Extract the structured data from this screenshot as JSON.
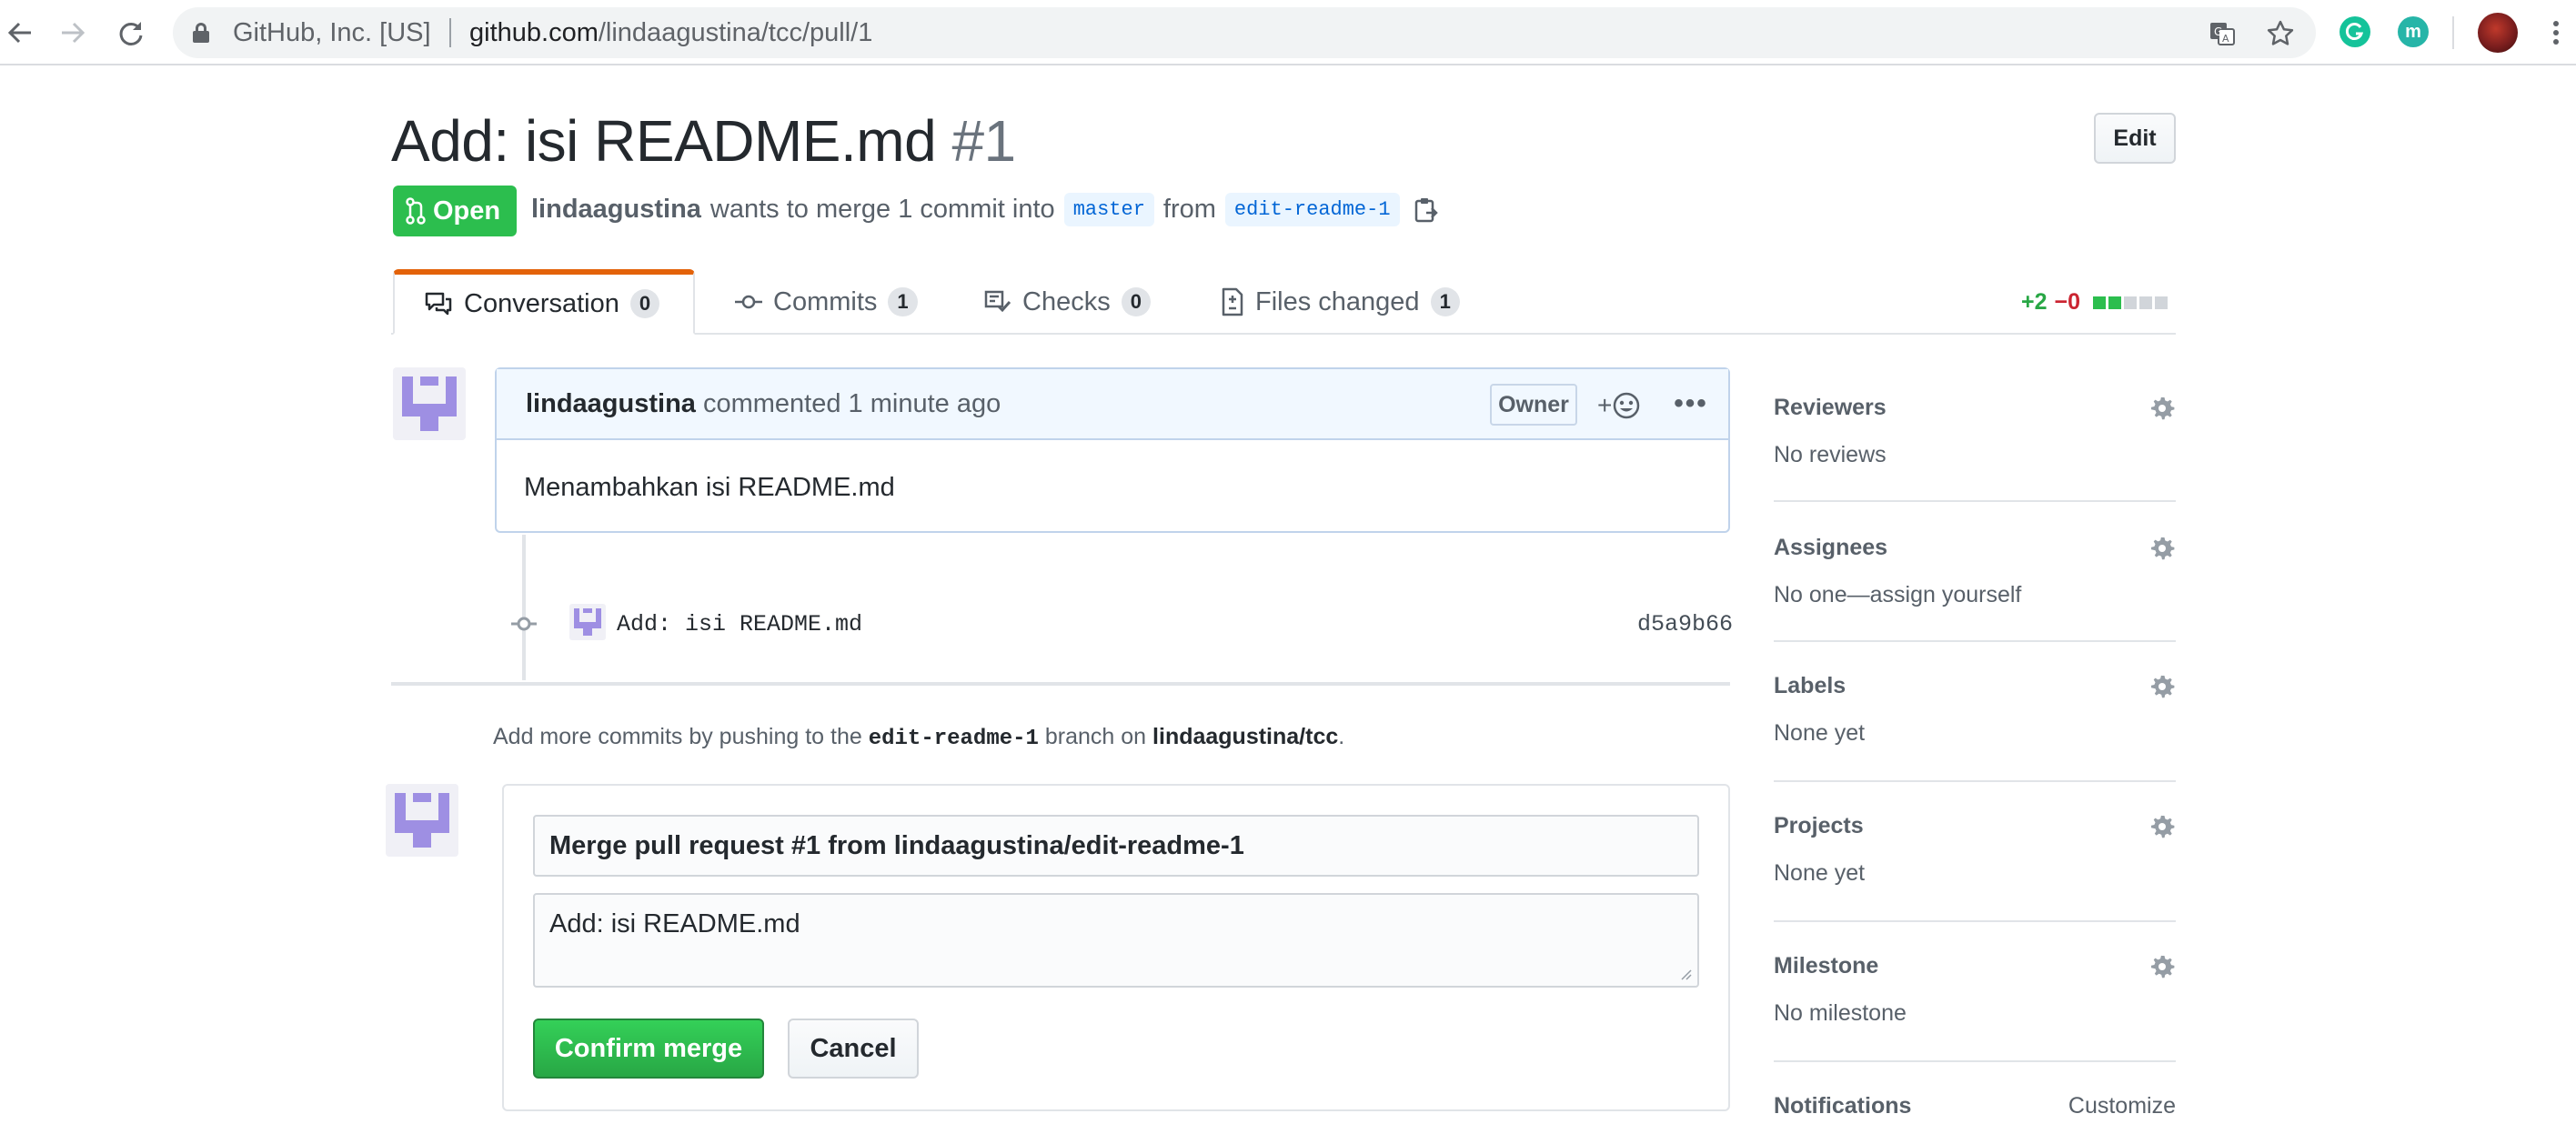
{
  "browser": {
    "site_identity": "GitHub, Inc. [US]",
    "url_host": "github.com",
    "url_path": "/lindaagustina/tcc/pull/1",
    "icons": [
      "back-icon",
      "forward-icon",
      "reload-icon",
      "lock-icon",
      "translate-icon",
      "star-icon",
      "grammarly-icon",
      "extension-icon",
      "profile-avatar"
    ],
    "ext_letter": "m"
  },
  "pr": {
    "title": "Add: isi README.md",
    "number": "#1",
    "edit_label": "Edit",
    "state": "Open",
    "author": "lindaagustina",
    "meta_text": "wants to merge 1 commit into",
    "base_branch": "master",
    "from_text": "from",
    "head_branch": "edit-readme-1"
  },
  "tabs": [
    {
      "label": "Conversation",
      "count": "0",
      "icon": "comment-discussion-icon"
    },
    {
      "label": "Commits",
      "count": "1",
      "icon": "git-commit-icon"
    },
    {
      "label": "Checks",
      "count": "0",
      "icon": "checklist-icon"
    },
    {
      "label": "Files changed",
      "count": "1",
      "icon": "file-diff-icon"
    }
  ],
  "diffstat": {
    "additions": "+2",
    "deletions": "−0",
    "blocks": [
      "#2cbe4e",
      "#2cbe4e",
      "#d1d5da",
      "#d1d5da",
      "#d1d5da"
    ]
  },
  "comment": {
    "author": "lindaagustina",
    "action": "commented 1 minute ago",
    "role": "Owner",
    "reaction_plus": "+",
    "more": "•••",
    "body": "Menambahkan isi README.md"
  },
  "commit": {
    "message": "Add: isi README.md",
    "sha": "d5a9b66"
  },
  "push_info": {
    "prefix": "Add more commits by pushing to the",
    "branch": "edit-readme-1",
    "middle": "branch on",
    "repo": "lindaagustina/tcc",
    "suffix": "."
  },
  "merge": {
    "title_value": "Merge pull request #1 from lindaagustina/edit-readme-1",
    "message_value": "Add: isi README.md",
    "confirm_label": "Confirm merge",
    "cancel_label": "Cancel"
  },
  "sidebar": {
    "reviewers": {
      "heading": "Reviewers",
      "value": "No reviews"
    },
    "assignees": {
      "heading": "Assignees",
      "value": "No one—assign yourself"
    },
    "labels": {
      "heading": "Labels",
      "value": "None yet"
    },
    "projects": {
      "heading": "Projects",
      "value": "None yet"
    },
    "milestone": {
      "heading": "Milestone",
      "value": "No milestone"
    },
    "notifications": {
      "heading": "Notifications",
      "action": "Customize"
    }
  },
  "colors": {
    "open_green": "#2cbe4e",
    "tab_accent": "#e36209",
    "link_blue": "#0366d6",
    "avatar_purple": "#9e8fe3",
    "addition_green": "#28a745",
    "deletion_red": "#cb2431"
  }
}
